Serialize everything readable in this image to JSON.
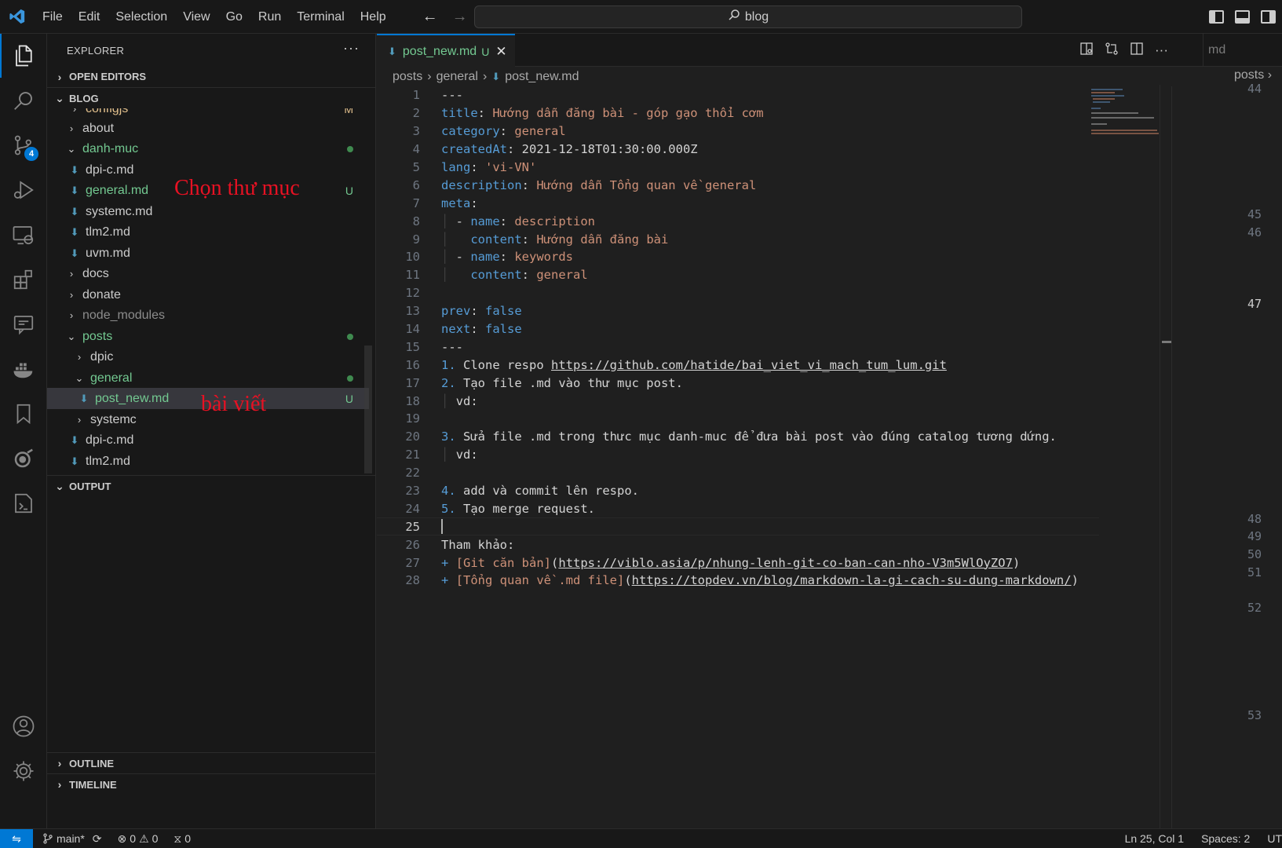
{
  "titlebar": {
    "menu": [
      "File",
      "Edit",
      "Selection",
      "View",
      "Go",
      "Run",
      "Terminal",
      "Help"
    ],
    "search_text": "blog"
  },
  "activity": {
    "scm_badge": "4"
  },
  "explorer": {
    "title": "EXPLORER",
    "more": "···",
    "open_editors": "OPEN EDITORS",
    "blog": "BLOG",
    "items": [
      {
        "label": "configjs",
        "deco": "M"
      },
      {
        "label": "about"
      },
      {
        "label": "danh-muc"
      },
      {
        "label": "dpi-c.md"
      },
      {
        "label": "general.md",
        "deco": "U"
      },
      {
        "label": "systemc.md"
      },
      {
        "label": "tlm2.md"
      },
      {
        "label": "uvm.md"
      },
      {
        "label": "docs"
      },
      {
        "label": "donate"
      },
      {
        "label": "node_modules"
      },
      {
        "label": "posts"
      },
      {
        "label": "dpic"
      },
      {
        "label": "general"
      },
      {
        "label": "post_new.md",
        "deco": "U"
      },
      {
        "label": "systemc"
      },
      {
        "label": "dpi-c.md"
      },
      {
        "label": "tlm2.md"
      }
    ],
    "output": "OUTPUT",
    "outline": "OUTLINE",
    "timeline": "TIMELINE",
    "annotation_folder": "Chọn thư mục",
    "annotation_post": "bài viết"
  },
  "editor": {
    "tab_label": "post_new.md",
    "tab_status": "U",
    "split_tab_label": "md",
    "breadcrumbs": [
      "posts",
      "general",
      "post_new.md"
    ],
    "split_breadcrumb": "posts",
    "lines": [
      {
        "n": "1",
        "t": "---"
      },
      {
        "n": "2",
        "k": "title",
        "v": "Hướng dẫn đăng bài - góp gạo thổi cơm"
      },
      {
        "n": "3",
        "k": "category",
        "v": "general"
      },
      {
        "n": "4",
        "k": "createdAt",
        "w": "2021-12-18T01:30:00.000Z"
      },
      {
        "n": "5",
        "k": "lang",
        "v": "'vi-VN'"
      },
      {
        "n": "6",
        "k": "description",
        "v": "Hướng dẫn Tổng quan về general"
      },
      {
        "n": "7",
        "k": "meta",
        "t": ":"
      },
      {
        "n": "8",
        "k": "name",
        "v": "description"
      },
      {
        "n": "9",
        "k": "content",
        "v": "Hướng dẫn đăng bài"
      },
      {
        "n": "10",
        "k": "name",
        "v": "keywords"
      },
      {
        "n": "11",
        "k": "content",
        "v": "general"
      },
      {
        "n": "12",
        "t": ""
      },
      {
        "n": "13",
        "k": "prev",
        "v": "false"
      },
      {
        "n": "14",
        "k": "next",
        "v": "false"
      },
      {
        "n": "15",
        "t": "---"
      },
      {
        "n": "16",
        "num": "1.",
        "t": "Clone respo ",
        "link": "https://github.com/hatide/bai_viet_vi_mach_tum_lum.git"
      },
      {
        "n": "17",
        "num": "2.",
        "t": "Tạo file .md vào thư mục post."
      },
      {
        "n": "18",
        "t": "vd:"
      },
      {
        "n": "19",
        "t": ""
      },
      {
        "n": "20",
        "num": "3.",
        "t": "Sửa file .md trong thưc mục danh-muc để đưa bài post vào đúng catalog tương dứng."
      },
      {
        "n": "21",
        "t": "vd:"
      },
      {
        "n": "22",
        "t": ""
      },
      {
        "n": "23",
        "num": "4.",
        "t": "add và commit lên respo."
      },
      {
        "n": "24",
        "num": "5.",
        "t": "Tạo merge request."
      },
      {
        "n": "25",
        "t": ""
      },
      {
        "n": "26",
        "t": "Tham khảo:"
      },
      {
        "n": "27",
        "plus": "+",
        "linktext": "[Git căn bản]",
        "url": "https://viblo.asia/p/nhung-lenh-git-co-ban-can-nho-V3m5WlOyZO7"
      },
      {
        "n": "28",
        "plus": "+",
        "linktext": "[Tổng quan về .md file]",
        "url": "https://topdev.vn/blog/markdown-la-gi-cach-su-dung-markdown/"
      }
    ],
    "split_lines": [
      "44",
      "45",
      "46",
      "47",
      "48",
      "49",
      "50",
      "51",
      "52",
      "53"
    ]
  },
  "status": {
    "branch": "main*",
    "errors": "0",
    "warnings": "0",
    "ports": "0",
    "position": "Ln 25, Col 1",
    "spaces": "Spaces: 2",
    "encoding": "UT"
  },
  "colors": {
    "accent": "#0078d4",
    "untracked": "#73c991",
    "yaml_key": "#569cd6",
    "yaml_value": "#ce9178",
    "annotation": "#e81123"
  }
}
